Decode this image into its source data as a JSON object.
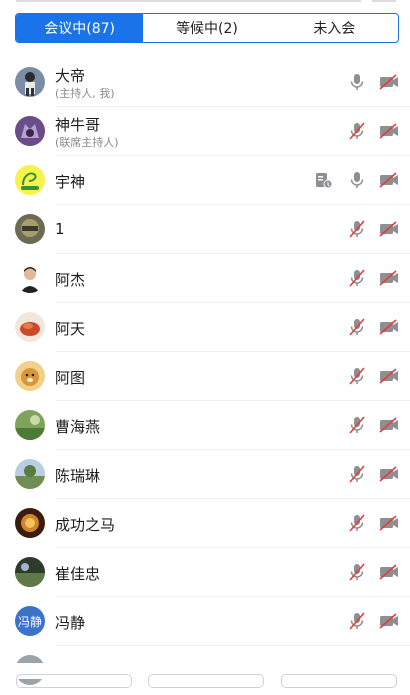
{
  "tabs": [
    {
      "label": "会议中(87)",
      "active": true
    },
    {
      "label": "等候中(2)",
      "active": false
    },
    {
      "label": "未入会",
      "active": false
    }
  ],
  "participants": [
    {
      "name": "大帝",
      "sub": "(主持人, 我)",
      "mic": "on",
      "camera": "off",
      "avatar": "photo"
    },
    {
      "name": "神牛哥",
      "sub": "(联席主持人)",
      "mic": "muted",
      "camera": "off",
      "avatar": "photo"
    },
    {
      "name": "宇神",
      "sub": "",
      "mic": "on",
      "camera": "off",
      "sharing": true,
      "avatar": "photo"
    },
    {
      "name": "1",
      "sub": "",
      "mic": "muted",
      "camera": "off",
      "avatar": "photo"
    },
    {
      "name": "阿杰",
      "sub": "",
      "mic": "muted",
      "camera": "off",
      "avatar": "photo"
    },
    {
      "name": "阿天",
      "sub": "",
      "mic": "muted",
      "camera": "off",
      "avatar": "photo"
    },
    {
      "name": "阿图",
      "sub": "",
      "mic": "muted",
      "camera": "off",
      "avatar": "photo"
    },
    {
      "name": "曹海燕",
      "sub": "",
      "mic": "muted",
      "camera": "off",
      "avatar": "photo"
    },
    {
      "name": "陈瑞琳",
      "sub": "",
      "mic": "muted",
      "camera": "off",
      "avatar": "photo"
    },
    {
      "name": "成功之马",
      "sub": "",
      "mic": "muted",
      "camera": "off",
      "avatar": "photo"
    },
    {
      "name": "崔佳忠",
      "sub": "",
      "mic": "muted",
      "camera": "off",
      "avatar": "photo"
    },
    {
      "name": "冯静",
      "sub": "",
      "mic": "muted",
      "camera": "off",
      "avatar": "text",
      "avatar_text": "冯静"
    }
  ],
  "colors": {
    "accent": "#1a73e8",
    "muted_red": "#e0403a",
    "icon_gray": "#8e8e93"
  }
}
